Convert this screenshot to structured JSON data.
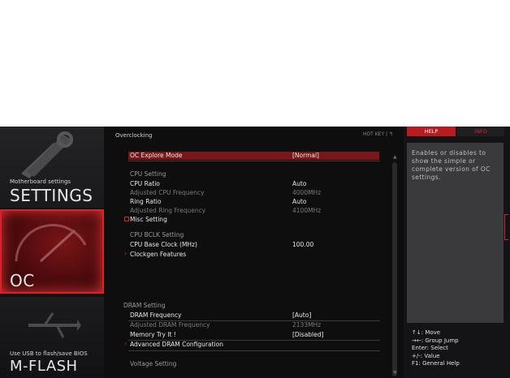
{
  "left": {
    "settings": {
      "small": "Motherboard settings",
      "big": "SETTINGS"
    },
    "oc": {
      "big": "OC"
    },
    "mflash": {
      "small": "Use USB to flash/save BIOS",
      "big": "M-FLASH"
    }
  },
  "main": {
    "breadcrumb": "Overclocking",
    "hotkey": "HOT KEY  |  ↰",
    "rows": [
      {
        "label": "OC Explore Mode",
        "value": "[Normal]"
      },
      {
        "label": "CPU Setting"
      },
      {
        "label": "CPU Ratio",
        "value": "Auto"
      },
      {
        "label": "Adjusted CPU Frequency",
        "value": "4000MHz"
      },
      {
        "label": "Ring Ratio",
        "value": "Auto"
      },
      {
        "label": "Adjusted Ring Frequency",
        "value": "4100MHz"
      },
      {
        "label": "Misc Setting"
      },
      {
        "label": "CPU  BCLK  Setting"
      },
      {
        "label": "CPU Base Clock (MHz)",
        "value": "100.00"
      },
      {
        "label": "Clockgen Features"
      },
      {
        "label": "DRAM  Setting"
      },
      {
        "label": "DRAM Frequency",
        "value": "[Auto]"
      },
      {
        "label": "Adjusted DRAM Frequency",
        "value": "2133MHz"
      },
      {
        "label": "Memory Try It !",
        "value": "[Disabled]"
      },
      {
        "label": "Advanced DRAM Configuration"
      },
      {
        "label": "Voltage  Setting"
      }
    ]
  },
  "right": {
    "tab_help": "HELP",
    "tab_info": "INFO",
    "help_text": "Enables or disables to show the simple or complete version of OC settings.",
    "keys": [
      "↑↓: Move",
      "→←: Group Jump",
      "Enter: Select",
      "+/-: Value",
      "F1: General Help"
    ]
  }
}
